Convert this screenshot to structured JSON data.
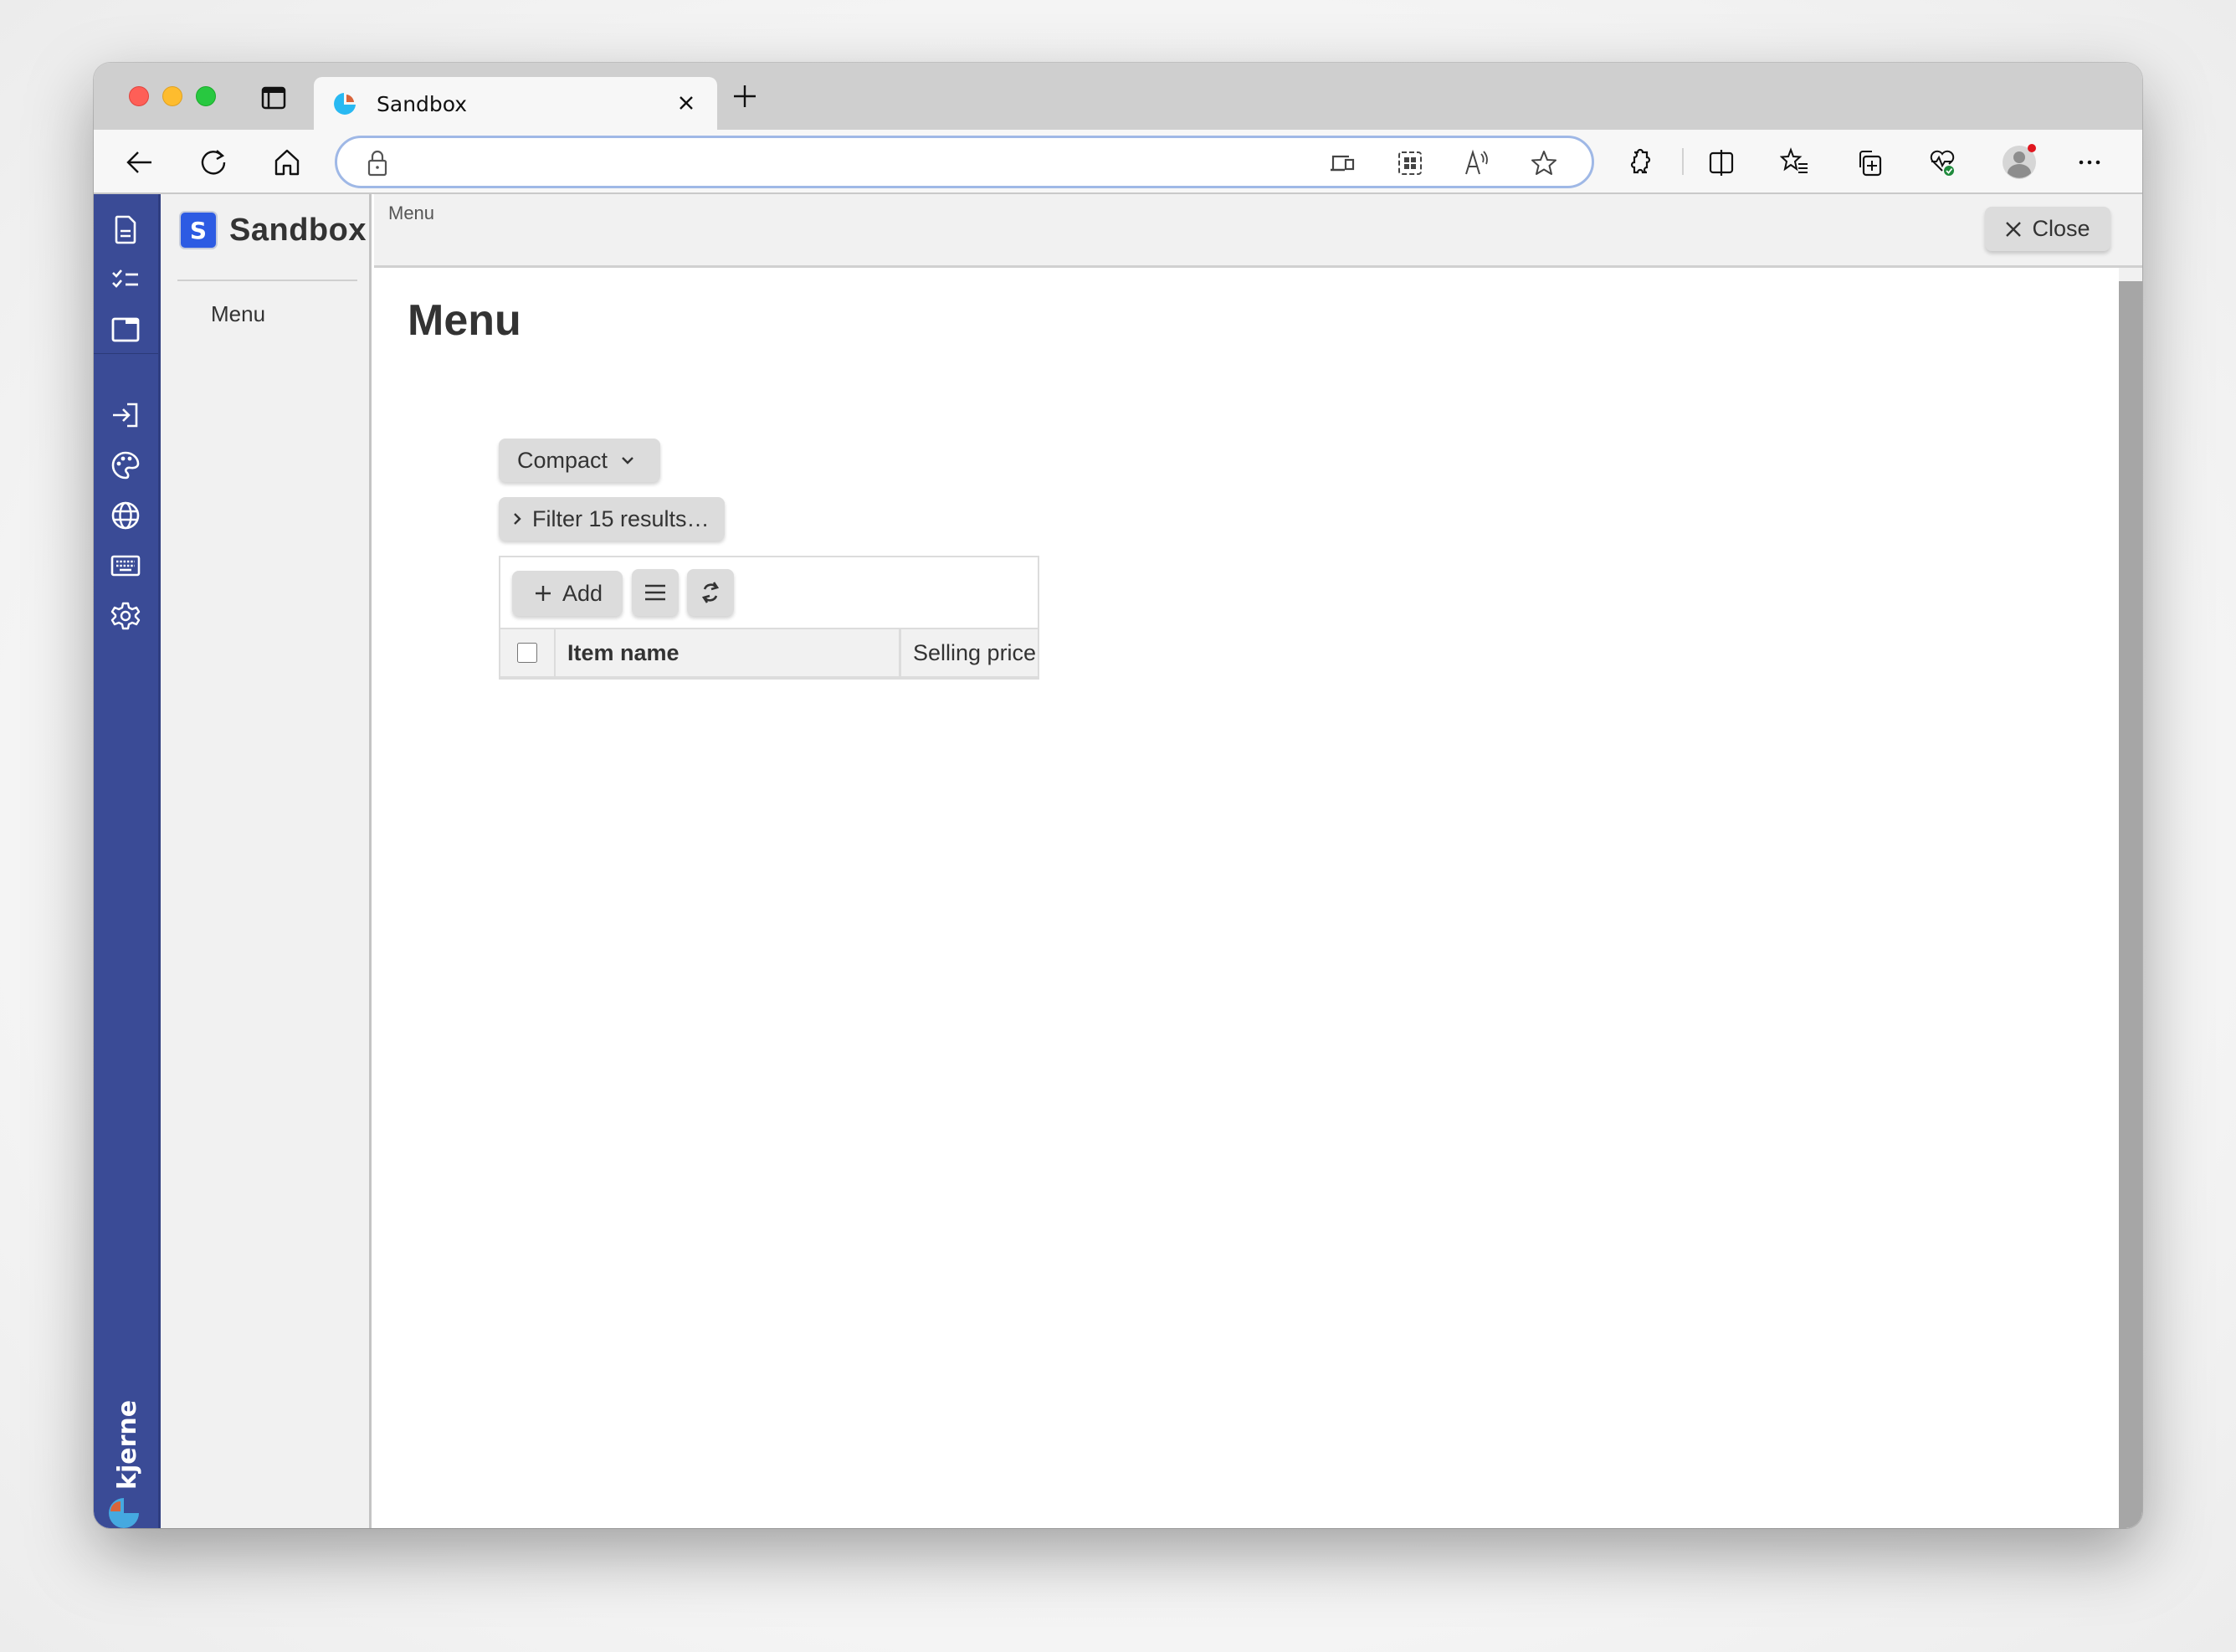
{
  "browser": {
    "tab": {
      "title": "Sandbox",
      "favicon": "kjerner-pie-icon"
    },
    "address_bar": {
      "value": "",
      "placeholder": ""
    },
    "toolbar_icons": [
      "back-icon",
      "reload-icon",
      "home-icon",
      "lock-icon",
      "device-icon",
      "apps-icon",
      "read-aloud-icon",
      "favorite-star-icon",
      "extensions-icon",
      "split-screen-icon",
      "favorites-icon",
      "collections-icon",
      "browser-essentials-icon",
      "profile-avatar-icon",
      "more-icon"
    ]
  },
  "app": {
    "rail_icons": [
      "document-icon",
      "checklist-icon",
      "window-icon",
      "login-icon",
      "palette-icon",
      "globe-icon",
      "keyboard-icon",
      "settings-icon"
    ],
    "rail_logo": "kjerner",
    "brand": {
      "badge": "S",
      "name": "Sandbox"
    },
    "nav": [
      {
        "label": "Menu"
      }
    ],
    "breadcrumb": "Menu",
    "close_label": "Close"
  },
  "main": {
    "title": "Menu",
    "view_select": {
      "value": "Compact"
    },
    "filter_label": "Filter 15 results…",
    "grid": {
      "add_label": "Add",
      "columns": [
        {
          "label": "Item name"
        },
        {
          "label": "Selling price"
        }
      ],
      "rows": []
    }
  },
  "colors": {
    "rail": "#3a4b96",
    "brand_badge": "#2d5be3",
    "address_focus": "#9fb8e6"
  }
}
